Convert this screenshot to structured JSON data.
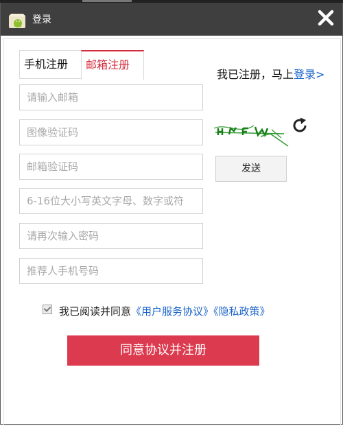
{
  "window": {
    "title": "登录"
  },
  "tabs": [
    {
      "label": "手机注册",
      "active": false
    },
    {
      "label": "邮箱注册",
      "active": true
    }
  ],
  "login_prompt": {
    "text": "我已注册，马上",
    "link": "登录>"
  },
  "form": {
    "email_placeholder": "请输入邮箱",
    "image_captcha_placeholder": "图像验证码",
    "email_code_placeholder": "邮箱验证码",
    "password_placeholder": "6-16位大小写英文字母、数字或符",
    "confirm_password_placeholder": "请再次输入密码",
    "referrer_placeholder": "推荐人手机号码"
  },
  "send_button": "发送",
  "agreement": {
    "checked": true,
    "text": "我已阅读并同意",
    "terms_link": "《用户服务协议》",
    "privacy_link": "《隐私政策》"
  },
  "submit_button": "同意协议并注册",
  "colors": {
    "accent": "#dc3a4e",
    "link": "#1a63c9",
    "titlebar": "#3f3f3f"
  },
  "icons": {
    "app": "android-app-icon",
    "close": "close-icon",
    "refresh": "refresh-icon"
  }
}
